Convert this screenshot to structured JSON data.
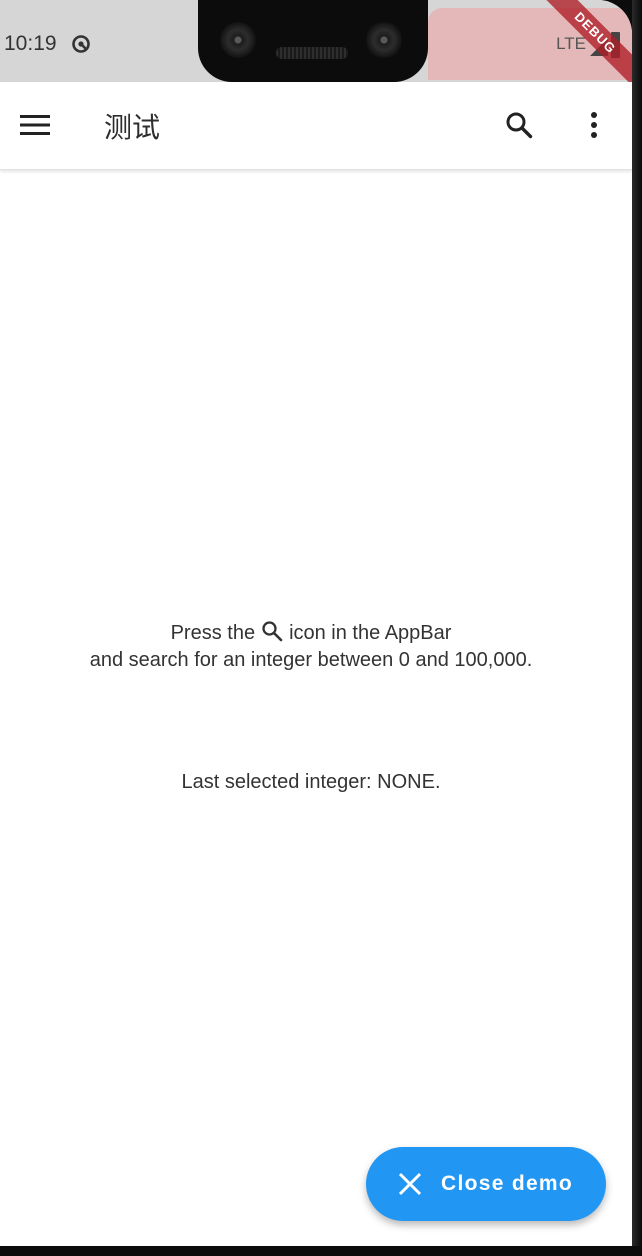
{
  "status_bar": {
    "time": "10:19",
    "network": "LTE",
    "debug_banner": "DEBUG"
  },
  "app_bar": {
    "title": "测试",
    "menu_icon": "menu-icon",
    "search_icon": "search-icon",
    "more_icon": "more-vert-icon"
  },
  "body": {
    "instruction_prefix": "Press the",
    "instruction_suffix": "icon in the AppBar",
    "instruction_line2": "and search for an integer between 0 and 100,000.",
    "last_selected": "Last selected integer: NONE."
  },
  "fab": {
    "label": "Close demo",
    "icon": "close-icon"
  },
  "colors": {
    "accent": "#2196f3",
    "status_bar": "#d6d6d6",
    "debug_banner": "#b01e26"
  }
}
